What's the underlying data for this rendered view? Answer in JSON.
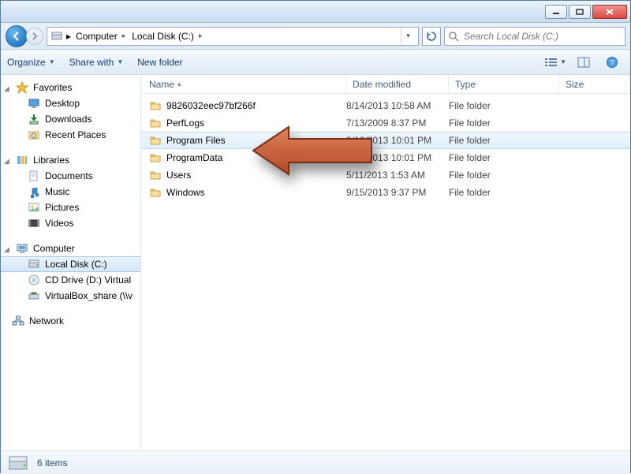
{
  "titlebar": {
    "min_label": "Minimize",
    "max_label": "Maximize",
    "close_label": "Close"
  },
  "address": {
    "crumbs": [
      "Computer",
      "Local Disk (C:)"
    ],
    "search_placeholder": "Search Local Disk (C:)"
  },
  "toolbar": {
    "organize": "Organize",
    "share": "Share with",
    "newfolder": "New folder"
  },
  "sidebar": {
    "favorites": {
      "label": "Favorites",
      "items": [
        "Desktop",
        "Downloads",
        "Recent Places"
      ]
    },
    "libraries": {
      "label": "Libraries",
      "items": [
        "Documents",
        "Music",
        "Pictures",
        "Videos"
      ]
    },
    "computer": {
      "label": "Computer",
      "items": [
        "Local Disk (C:)",
        "CD Drive (D:) Virtual",
        "VirtualBox_share (\\\\v"
      ]
    },
    "network": {
      "label": "Network"
    }
  },
  "columns": {
    "name": "Name",
    "date": "Date modified",
    "type": "Type",
    "size": "Size"
  },
  "rows": [
    {
      "name": "9826032eec97bf266f",
      "date": "8/14/2013 10:58 AM",
      "type": "File folder"
    },
    {
      "name": "PerfLogs",
      "date": "7/13/2009 8:37 PM",
      "type": "File folder"
    },
    {
      "name": "Program Files",
      "date": "9/12/2013 10:01 PM",
      "type": "File folder",
      "selected": true
    },
    {
      "name": "ProgramData",
      "date": "9/12/2013 10:01 PM",
      "type": "File folder"
    },
    {
      "name": "Users",
      "date": "5/11/2013 1:53 AM",
      "type": "File folder"
    },
    {
      "name": "Windows",
      "date": "9/15/2013 9:37 PM",
      "type": "File folder"
    }
  ],
  "status": {
    "count": "6 items"
  },
  "colors": {
    "accent": "#2d84c8",
    "arrow": "#c15a36"
  }
}
